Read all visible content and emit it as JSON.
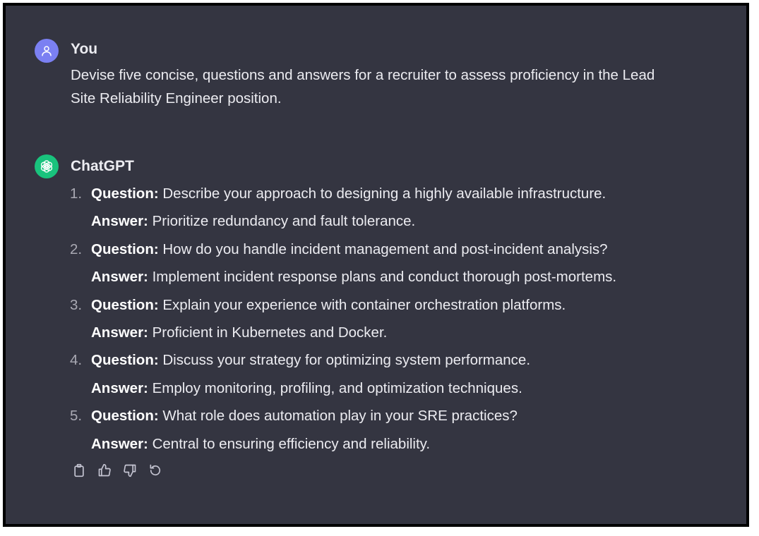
{
  "user": {
    "name": "You",
    "message": "Devise five concise, questions and answers for a recruiter to assess proficiency in the Lead Site Reliability Engineer position."
  },
  "assistant": {
    "name": "ChatGPT",
    "question_label": "Question:",
    "answer_label": "Answer:",
    "items": [
      {
        "number": "1.",
        "question": "Describe your approach to designing a highly available infrastructure.",
        "answer": "Prioritize redundancy and fault tolerance."
      },
      {
        "number": "2.",
        "question": "How do you handle incident management and post-incident analysis?",
        "answer": "Implement incident response plans and conduct thorough post-mortems."
      },
      {
        "number": "3.",
        "question": "Explain your experience with container orchestration platforms.",
        "answer": "Proficient in Kubernetes and Docker."
      },
      {
        "number": "4.",
        "question": "Discuss your strategy for optimizing system performance.",
        "answer": "Employ monitoring, profiling, and optimization techniques."
      },
      {
        "number": "5.",
        "question": "What role does automation play in your SRE practices?",
        "answer": "Central to ensuring efficiency and reliability."
      }
    ]
  },
  "actions": [
    "copy-icon",
    "thumbs-up-icon",
    "thumbs-down-icon",
    "regenerate-icon"
  ],
  "colors": {
    "background": "#343541",
    "user_avatar": "#7b80f2",
    "assistant_avatar": "#19c37d",
    "text": "#ececf1",
    "muted": "#a9a9b3"
  }
}
